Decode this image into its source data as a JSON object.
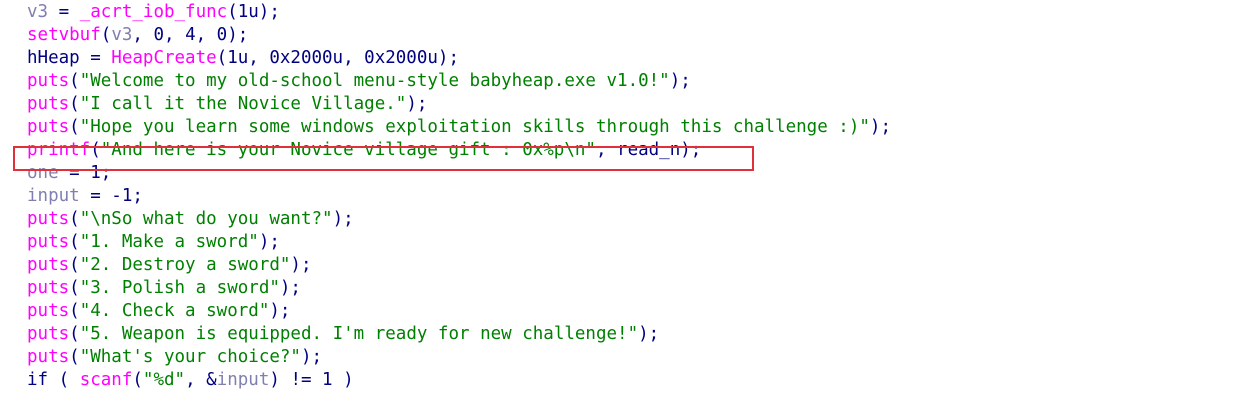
{
  "code_lines": [
    [
      {
        "t": "v3",
        "c": "t-var"
      },
      {
        "t": " = ",
        "c": "t-op"
      },
      {
        "t": "_acrt_iob_func",
        "c": "t-fn"
      },
      {
        "t": "(1u);",
        "c": "t-op"
      }
    ],
    [
      {
        "t": "setvbuf",
        "c": "t-fn"
      },
      {
        "t": "(",
        "c": "t-op"
      },
      {
        "t": "v3",
        "c": "t-var"
      },
      {
        "t": ", 0, 4, 0);",
        "c": "t-op"
      }
    ],
    [
      {
        "t": "hHeap",
        "c": "t-txt"
      },
      {
        "t": " = ",
        "c": "t-op"
      },
      {
        "t": "HeapCreate",
        "c": "t-fn"
      },
      {
        "t": "(1u, 0x2000u, 0x2000u);",
        "c": "t-op"
      }
    ],
    [
      {
        "t": "puts",
        "c": "t-fn"
      },
      {
        "t": "(",
        "c": "t-op"
      },
      {
        "t": "\"Welcome to my old-school menu-style babyheap.exe v1.0!\"",
        "c": "t-str"
      },
      {
        "t": ");",
        "c": "t-op"
      }
    ],
    [
      {
        "t": "puts",
        "c": "t-fn"
      },
      {
        "t": "(",
        "c": "t-op"
      },
      {
        "t": "\"I call it the Novice Village.\"",
        "c": "t-str"
      },
      {
        "t": ");",
        "c": "t-op"
      }
    ],
    [
      {
        "t": "puts",
        "c": "t-fn"
      },
      {
        "t": "(",
        "c": "t-op"
      },
      {
        "t": "\"Hope you learn some windows exploitation skills through this challenge :)\"",
        "c": "t-str"
      },
      {
        "t": ");",
        "c": "t-op"
      }
    ],
    [
      {
        "t": "printf",
        "c": "t-fn"
      },
      {
        "t": "(",
        "c": "t-op"
      },
      {
        "t": "\"And here is your Novice village gift : 0x%p\\n\"",
        "c": "t-str"
      },
      {
        "t": ", ",
        "c": "t-op"
      },
      {
        "t": "read_n",
        "c": "t-txt"
      },
      {
        "t": ");",
        "c": "t-op"
      }
    ],
    [
      {
        "t": "one",
        "c": "t-var"
      },
      {
        "t": " = 1;",
        "c": "t-op"
      }
    ],
    [
      {
        "t": "input",
        "c": "t-var"
      },
      {
        "t": " = -1;",
        "c": "t-op"
      }
    ],
    [
      {
        "t": "puts",
        "c": "t-fn"
      },
      {
        "t": "(",
        "c": "t-op"
      },
      {
        "t": "\"\\nSo what do you want?\"",
        "c": "t-str"
      },
      {
        "t": ");",
        "c": "t-op"
      }
    ],
    [
      {
        "t": "puts",
        "c": "t-fn"
      },
      {
        "t": "(",
        "c": "t-op"
      },
      {
        "t": "\"1. Make a sword\"",
        "c": "t-str"
      },
      {
        "t": ");",
        "c": "t-op"
      }
    ],
    [
      {
        "t": "puts",
        "c": "t-fn"
      },
      {
        "t": "(",
        "c": "t-op"
      },
      {
        "t": "\"2. Destroy a sword\"",
        "c": "t-str"
      },
      {
        "t": ");",
        "c": "t-op"
      }
    ],
    [
      {
        "t": "puts",
        "c": "t-fn"
      },
      {
        "t": "(",
        "c": "t-op"
      },
      {
        "t": "\"3. Polish a sword\"",
        "c": "t-str"
      },
      {
        "t": ");",
        "c": "t-op"
      }
    ],
    [
      {
        "t": "puts",
        "c": "t-fn"
      },
      {
        "t": "(",
        "c": "t-op"
      },
      {
        "t": "\"4. Check a sword\"",
        "c": "t-str"
      },
      {
        "t": ");",
        "c": "t-op"
      }
    ],
    [
      {
        "t": "puts",
        "c": "t-fn"
      },
      {
        "t": "(",
        "c": "t-op"
      },
      {
        "t": "\"5. Weapon is equipped. I'm ready for new challenge!\"",
        "c": "t-str"
      },
      {
        "t": ");",
        "c": "t-op"
      }
    ],
    [
      {
        "t": "puts",
        "c": "t-fn"
      },
      {
        "t": "(",
        "c": "t-op"
      },
      {
        "t": "\"What's your choice?\"",
        "c": "t-str"
      },
      {
        "t": ");",
        "c": "t-op"
      }
    ],
    [
      {
        "t": "if",
        "c": "t-kw"
      },
      {
        "t": " ( ",
        "c": "t-op"
      },
      {
        "t": "scanf",
        "c": "t-fn"
      },
      {
        "t": "(",
        "c": "t-op"
      },
      {
        "t": "\"%d\"",
        "c": "t-str"
      },
      {
        "t": ", &",
        "c": "t-op"
      },
      {
        "t": "input",
        "c": "t-var"
      },
      {
        "t": ") != 1 )",
        "c": "t-op"
      }
    ]
  ],
  "highlighted_line": 6,
  "colors": {
    "background": "#ffffff",
    "default_text": "#000080",
    "variable": "#8080b0",
    "function": "#ff00ff",
    "string": "#008000",
    "highlight_border": "#e0303a"
  }
}
